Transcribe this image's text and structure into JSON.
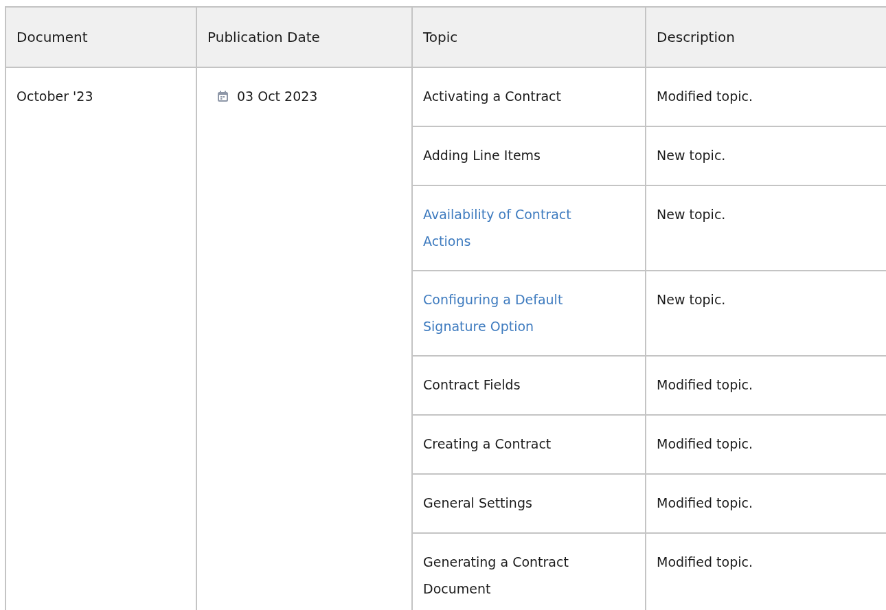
{
  "table": {
    "columns": [
      "Document",
      "Publication Date",
      "Topic",
      "Description"
    ],
    "document": "October '23",
    "publication_date": "03 Oct 2023",
    "rows": [
      {
        "topic": "Activating a Contract",
        "kind": "text",
        "description": "Modified topic."
      },
      {
        "topic": "Adding Line Items",
        "kind": "text",
        "description": "New topic."
      },
      {
        "topic": "Availability of Contract Actions",
        "kind": "link",
        "description": "New topic."
      },
      {
        "topic": "Configuring a Default Signature Option",
        "kind": "link",
        "description": "New topic."
      },
      {
        "topic": "Contract Fields",
        "kind": "text",
        "description": "Modified topic."
      },
      {
        "topic": "Creating a Contract",
        "kind": "text",
        "description": "Modified topic."
      },
      {
        "topic": "General Settings",
        "kind": "text",
        "description": "Modified topic."
      },
      {
        "topic": "Generating a Contract Document",
        "kind": "text",
        "description": "Modified topic."
      }
    ]
  }
}
